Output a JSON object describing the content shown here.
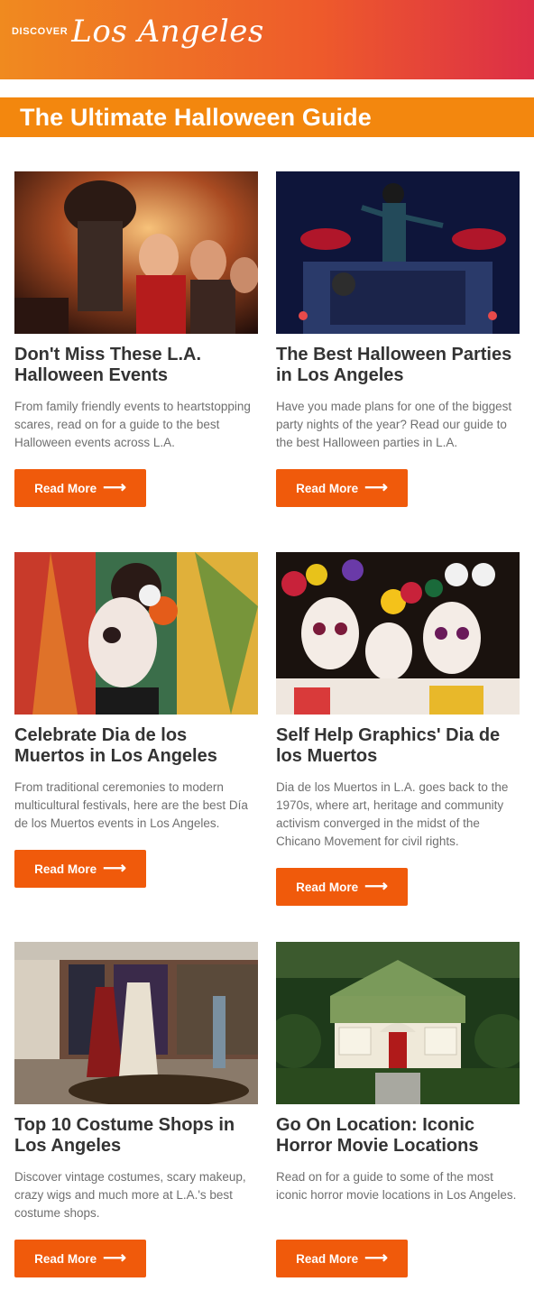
{
  "header": {
    "brand_small": "DISCOVER",
    "brand_script": "Los Angeles"
  },
  "hero": {
    "title": "The Ultimate Halloween Guide"
  },
  "cards": [
    {
      "title": "Don't Miss These L.A. Halloween Events",
      "description": "From family friendly events to heartstopping scares, read on for a guide to the best Halloween events across L.A.",
      "button": "Read More",
      "image": "halloween-events-photo"
    },
    {
      "title": "The Best Halloween Parties in Los Angeles",
      "description": "Have you made plans for one of the biggest party nights of the year? Read our guide to the best Halloween parties in L.A.",
      "button": "Read More",
      "image": "halloween-parties-photo"
    },
    {
      "title": "Celebrate Dia de los Muertos in Los Angeles",
      "description": "From traditional ceremonies to modern multicultural festivals, here are the best Día de los Muertos events in Los Angeles.",
      "button": "Read More",
      "image": "dia-de-los-muertos-photo"
    },
    {
      "title": "Self Help Graphics' Dia de los Muertos",
      "description": "Dia de los Muertos in L.A. goes back to the 1970s, where art, heritage and community activism converged in the midst of the Chicano Movement for civil rights.",
      "button": "Read More",
      "image": "self-help-graphics-photo"
    },
    {
      "title": "Top 10 Costume Shops in Los Angeles",
      "description": "Discover vintage costumes, scary makeup, crazy wigs and much more at L.A.'s best costume shops.",
      "button": "Read More",
      "image": "costume-shop-photo"
    },
    {
      "title": "Go On Location: Iconic Horror Movie Locations",
      "description": "Read on for a guide to some of the most iconic horror movie locations in Los Angeles.",
      "button": "Read More",
      "image": "horror-movie-house-photo"
    }
  ],
  "colors": {
    "accent_orange": "#f3870e",
    "button_orange": "#f05a0b",
    "header_gradient_start": "#f08a1f",
    "header_gradient_end": "#dc2e47"
  }
}
